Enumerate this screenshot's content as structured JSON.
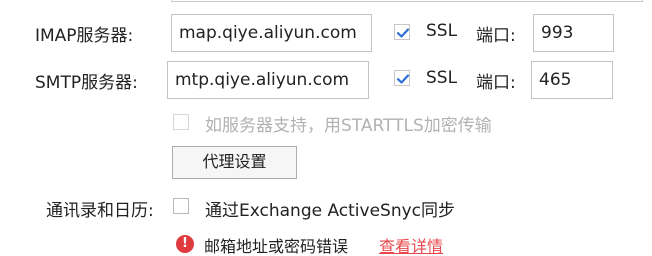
{
  "imap": {
    "label": "IMAP服务器:",
    "server_value": "map.qiye.aliyun.com",
    "ssl_checked": true,
    "ssl_label": "SSL",
    "port_label": "端口:",
    "port_value": "993"
  },
  "smtp": {
    "label": "SMTP服务器:",
    "server_value": "mtp.qiye.aliyun.com",
    "ssl_checked": true,
    "ssl_label": "SSL",
    "port_label": "端口:",
    "port_value": "465"
  },
  "starttls": {
    "checked": false,
    "disabled": true,
    "label": "如服务器支持，用STARTTLS加密传输"
  },
  "proxy_button": {
    "label": "代理设置"
  },
  "contacts": {
    "label": "通讯录和日历:",
    "checkbox_checked": false,
    "checkbox_label": "通过Exchange ActiveSnyc同步"
  },
  "error": {
    "icon": "error-icon",
    "message": "邮箱地址或密码错误",
    "link_label": "查看详情"
  },
  "colors": {
    "checkmark": "#2f6fd6",
    "error": "#e03a3e",
    "link": "#e8474b"
  }
}
